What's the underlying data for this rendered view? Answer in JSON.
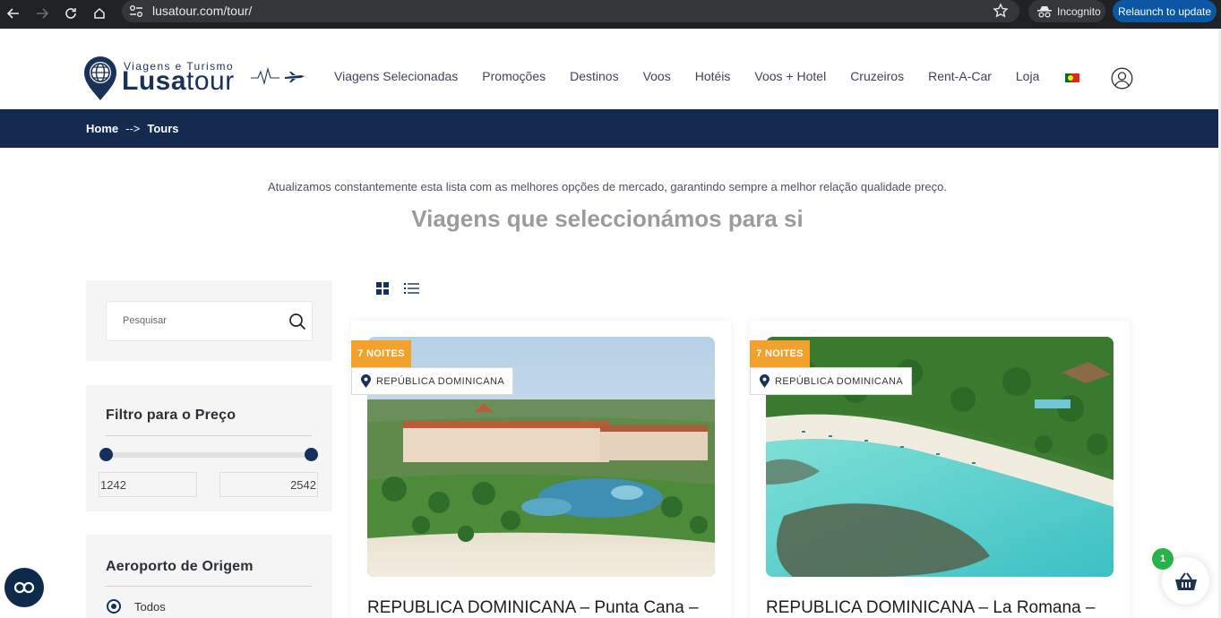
{
  "browser": {
    "url": "lusatour.com/tour/",
    "incognito_label": "Incognito",
    "relaunch_label": "Relaunch to update"
  },
  "logo": {
    "tagline": "Viagens e Turismo",
    "name_bold": "Lusa",
    "name_light": "tour"
  },
  "nav": {
    "items": [
      "Viagens Selecionadas",
      "Promoções",
      "Destinos",
      "Voos",
      "Hotéis",
      "Voos + Hotel",
      "Cruzeiros",
      "Rent-A-Car",
      "Loja"
    ],
    "language_flag": "portugal-flag"
  },
  "breadcrumb": {
    "home": "Home",
    "current": "Tours",
    "separator": "-->"
  },
  "intro": {
    "text": "Atualizamos constantemente esta lista com as melhores opções de mercado, garantindo sempre a melhor relação qualidade preço.",
    "headline": "Viagens que seleccionámos para si"
  },
  "sidebar": {
    "search_placeholder": "Pesquisar",
    "price_filter": {
      "title": "Filtro para o Preço",
      "min": "1242",
      "max": "2542"
    },
    "airport": {
      "title": "Aeroporto de Origem",
      "selected_option": "Todos"
    }
  },
  "tours": [
    {
      "badge": "7 NOITES",
      "location": "REPÚBLICA DOMINICANA",
      "title": "REPUBLICA DOMINICANA – Punta Cana –"
    },
    {
      "badge": "7 NOITES",
      "location": "REPÚBLICA DOMINICANA",
      "title": "REPUBLICA DOMINICANA – La Romana –"
    }
  ],
  "cart": {
    "count": "1"
  },
  "colors": {
    "brand_navy": "#152a4f",
    "badge_orange": "#f2a22c",
    "cart_green": "#27b34a",
    "chrome_dark": "#202124"
  }
}
